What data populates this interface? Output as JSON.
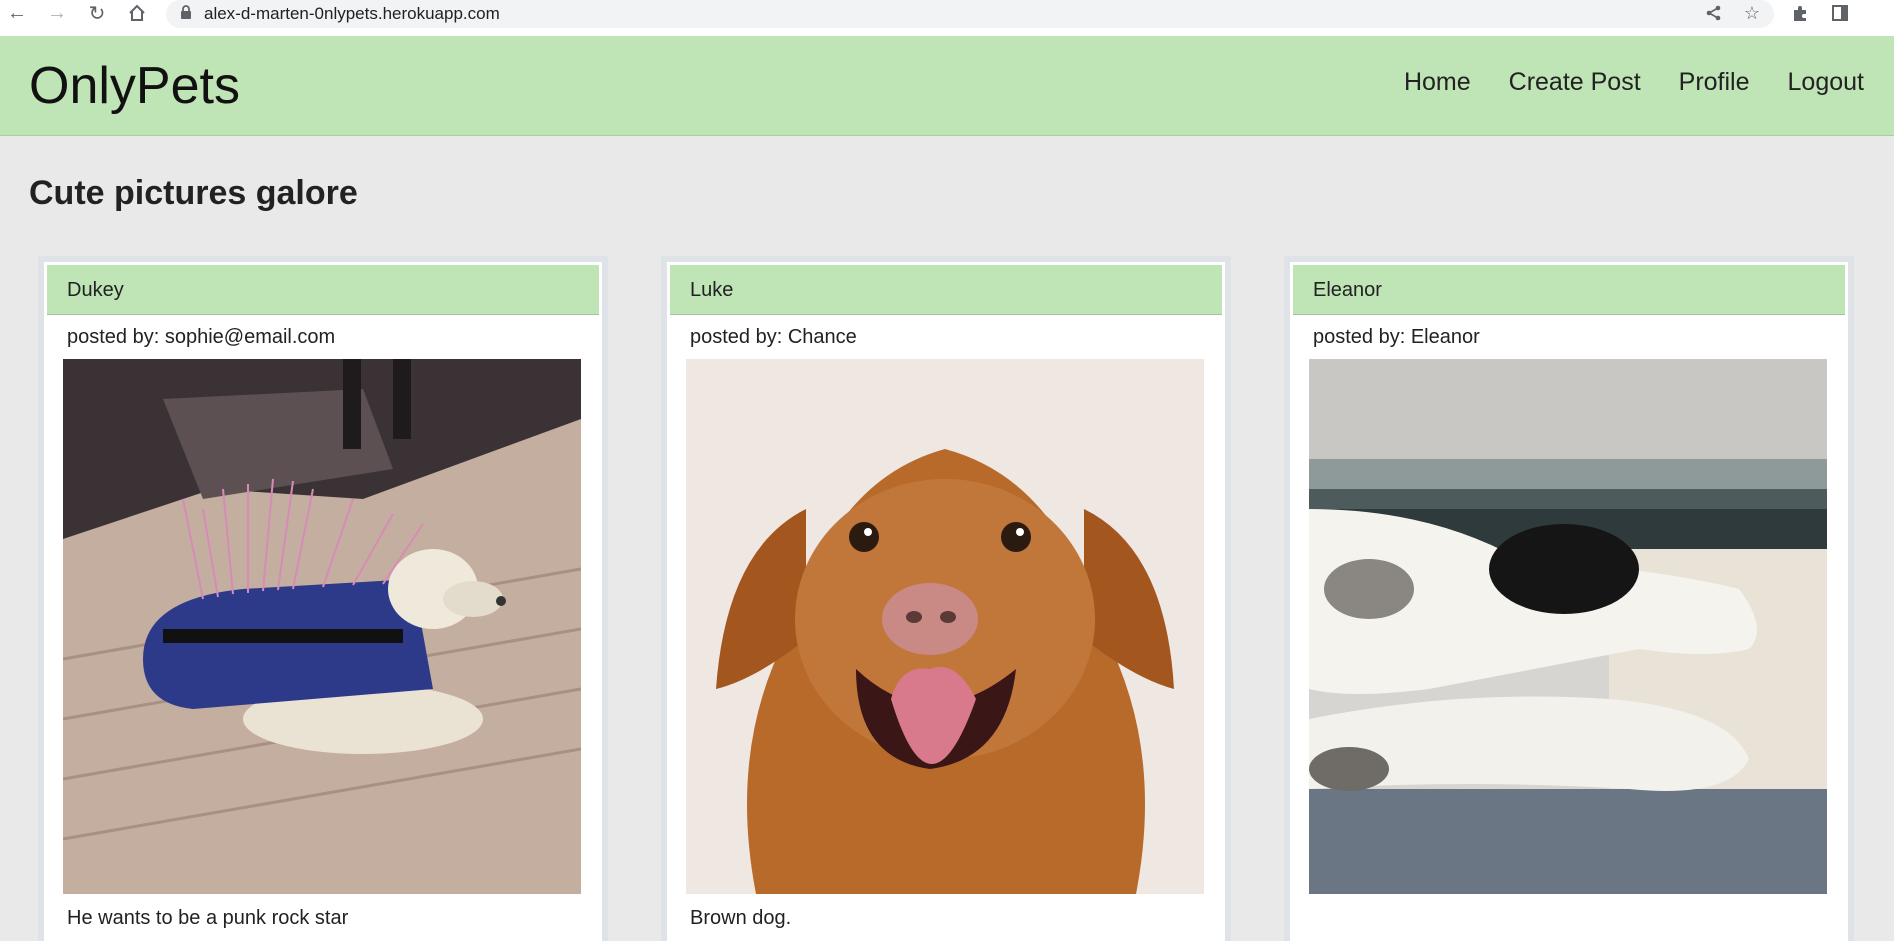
{
  "browser": {
    "url": "alex-d-marten-0nlypets.herokuapp.com",
    "back_icon": "back-arrow-icon",
    "forward_icon": "forward-arrow-icon",
    "reload_icon": "reload-icon",
    "home_icon": "home-icon",
    "lock_icon": "lock-icon",
    "share_icon": "share-icon",
    "bookmark_icon": "star-icon",
    "extensions_icon": "puzzle-icon",
    "sidepanel_icon": "side-panel-icon"
  },
  "header": {
    "brand": "OnlyPets",
    "nav": [
      "Home",
      "Create Post",
      "Profile",
      "Logout"
    ],
    "color": "#bfe4b5"
  },
  "page": {
    "title": "Cute pictures galore"
  },
  "posts": [
    {
      "name": "Dukey",
      "author": "posted by: sophie@email.com",
      "caption": "He wants to be a punk rock star",
      "image": "dog in spiky punk costume on deck"
    },
    {
      "name": "Luke",
      "author": "posted by: Chance",
      "caption": "Brown dog.",
      "image": "smiling brown dog portrait"
    },
    {
      "name": "Eleanor",
      "author": "posted by: Eleanor",
      "caption": "",
      "image": "black and white cat paws at window"
    }
  ]
}
